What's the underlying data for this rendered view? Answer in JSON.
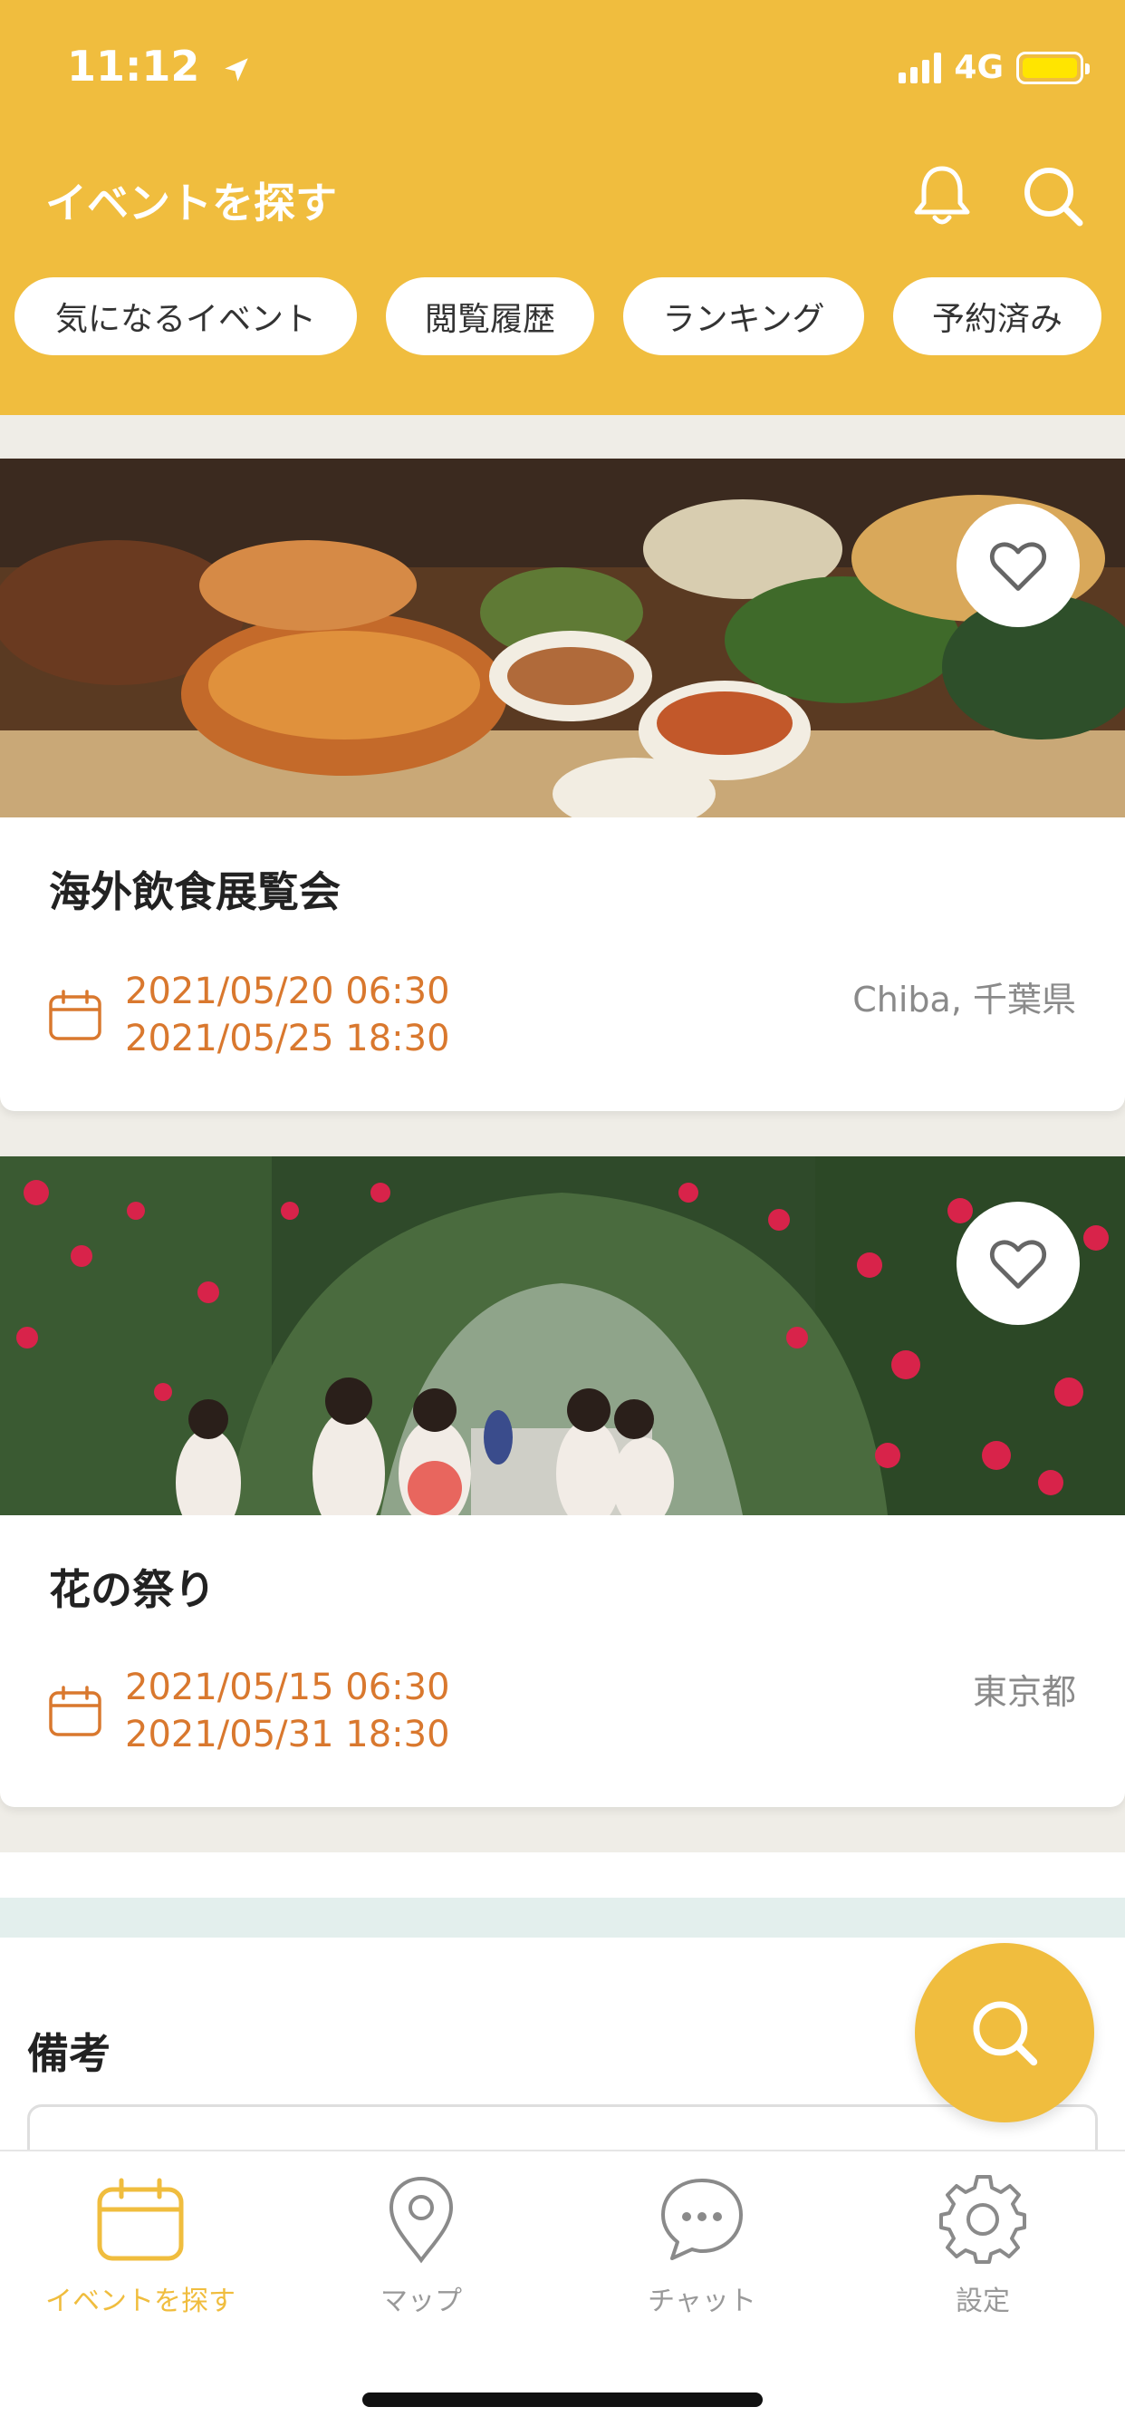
{
  "status_bar": {
    "time": "11:12",
    "network": "4G"
  },
  "header": {
    "title": "イベントを探す",
    "chips": [
      "気になるイベント",
      "閲覧履歴",
      "ランキング",
      "予約済み"
    ]
  },
  "events": [
    {
      "title": "海外飲食展覧会",
      "start": "2021/05/20 06:30",
      "end": "2021/05/25 18:30",
      "location": "Chiba, 千葉県",
      "icon": "calendar-icon"
    },
    {
      "title": "花の祭り",
      "start": "2021/05/15 06:30",
      "end": "2021/05/31 18:30",
      "location": "東京都",
      "icon": "calendar-icon"
    }
  ],
  "notes": {
    "label": "備考"
  },
  "tabs": [
    {
      "label": "イベントを探す",
      "icon": "calendar-icon",
      "active": true
    },
    {
      "label": "マップ",
      "icon": "map-pin-icon",
      "active": false
    },
    {
      "label": "チャット",
      "icon": "chat-icon",
      "active": false
    },
    {
      "label": "設定",
      "icon": "gear-icon",
      "active": false
    }
  ],
  "colors": {
    "accent": "#f0bd3e",
    "date": "#d9782e",
    "muted": "#999999"
  }
}
